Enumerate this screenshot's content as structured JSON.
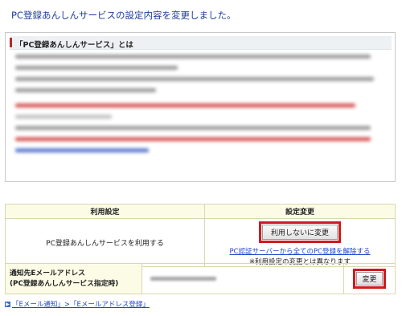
{
  "page_title": "PC登録あんしんサービスの設定内容を変更しました。",
  "info": {
    "heading": "「PC登録あんしんサービス」とは"
  },
  "settings_table": {
    "header_left": "利用設定",
    "header_right": "設定変更",
    "row_label": "PC登録あんしんサービスを利用する",
    "change_button": "利用しないに変更",
    "release_link": "PC認証サーバーから全てのPC登録を解除する",
    "note": "※利用設定の変更とは異なります"
  },
  "mail_table": {
    "label_line1": "通知先Eメールアドレス",
    "label_line2": "(PC登録あんしんサービス指定時)",
    "change_button": "変更"
  },
  "bottom_link": "「Eメール通知」>「Eメールアドレス登録」",
  "colors": {
    "title": "#1f3d9c",
    "highlight_border": "#d11a1a",
    "link": "#2244cc",
    "table_header_bg": "#fbfbe6"
  }
}
